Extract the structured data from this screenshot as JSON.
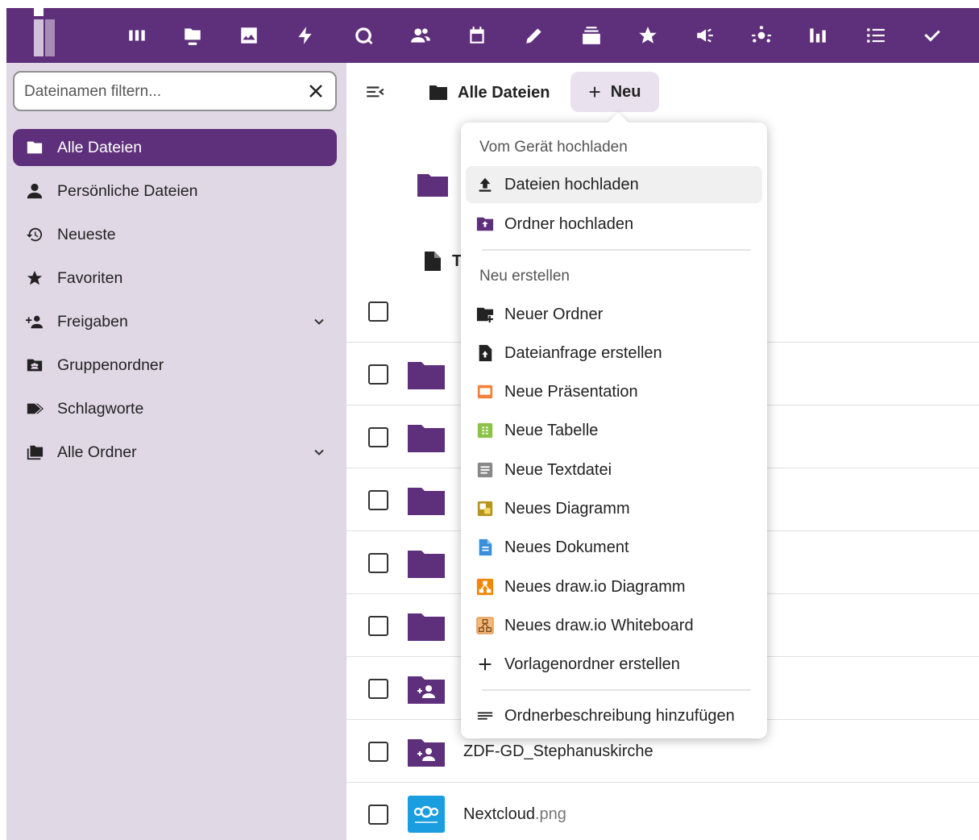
{
  "colors": {
    "brand": "#5e2f7a",
    "sidebar_bg": "#e1d8e6",
    "new_button_bg": "#e9e2ee"
  },
  "topbar": {
    "apps": [
      "dashboard-icon",
      "files-icon",
      "photos-icon",
      "activity-icon",
      "search-icon",
      "contacts-icon",
      "calendar-icon",
      "notes-icon",
      "deck-icon",
      "favorites-icon",
      "announcements-icon",
      "circles-icon",
      "analytics-icon",
      "tasks-icon",
      "checkmark-icon"
    ]
  },
  "sidebar": {
    "filter_placeholder": "Dateinamen filtern...",
    "items": [
      {
        "label": "Alle Dateien",
        "icon": "folder-icon",
        "active": true
      },
      {
        "label": "Persönliche Dateien",
        "icon": "person-icon"
      },
      {
        "label": "Neueste",
        "icon": "history-icon"
      },
      {
        "label": "Favoriten",
        "icon": "star-icon"
      },
      {
        "label": "Freigaben",
        "icon": "share-icon",
        "expandable": true
      },
      {
        "label": "Gruppenordner",
        "icon": "group-folder-icon"
      },
      {
        "label": "Schlagworte",
        "icon": "tag-icon"
      },
      {
        "label": "Alle Ordner",
        "icon": "folder-multiple-icon",
        "expandable": true
      }
    ]
  },
  "header": {
    "breadcrumb": "Alle Dateien",
    "new_button": "Neu"
  },
  "partial_header_letter": "T",
  "files": [
    {
      "type": "folder"
    },
    {
      "type": "folder"
    },
    {
      "type": "folder"
    },
    {
      "type": "folder"
    },
    {
      "type": "folder"
    },
    {
      "type": "shared-folder"
    },
    {
      "type": "shared-folder",
      "name": "ZDF-GD_Stephanuskirche"
    },
    {
      "type": "image",
      "name": "Nextcloud",
      "ext": ".png"
    }
  ],
  "menu": {
    "caption_upload": "Vom Gerät hochladen",
    "upload_files": "Dateien hochladen",
    "upload_folder": "Ordner hochladen",
    "caption_create": "Neu erstellen",
    "new_folder": "Neuer Ordner",
    "file_request": "Dateianfrage erstellen",
    "new_presentation": "Neue Präsentation",
    "new_spreadsheet": "Neue Tabelle",
    "new_textfile": "Neue Textdatei",
    "new_diagram": "Neues Diagramm",
    "new_document": "Neues Dokument",
    "new_drawio_diagram": "Neues draw.io Diagramm",
    "new_drawio_whiteboard": "Neues draw.io Whiteboard",
    "create_template_folder": "Vorlagenordner erstellen",
    "add_folder_description": "Ordnerbeschreibung hinzufügen"
  }
}
